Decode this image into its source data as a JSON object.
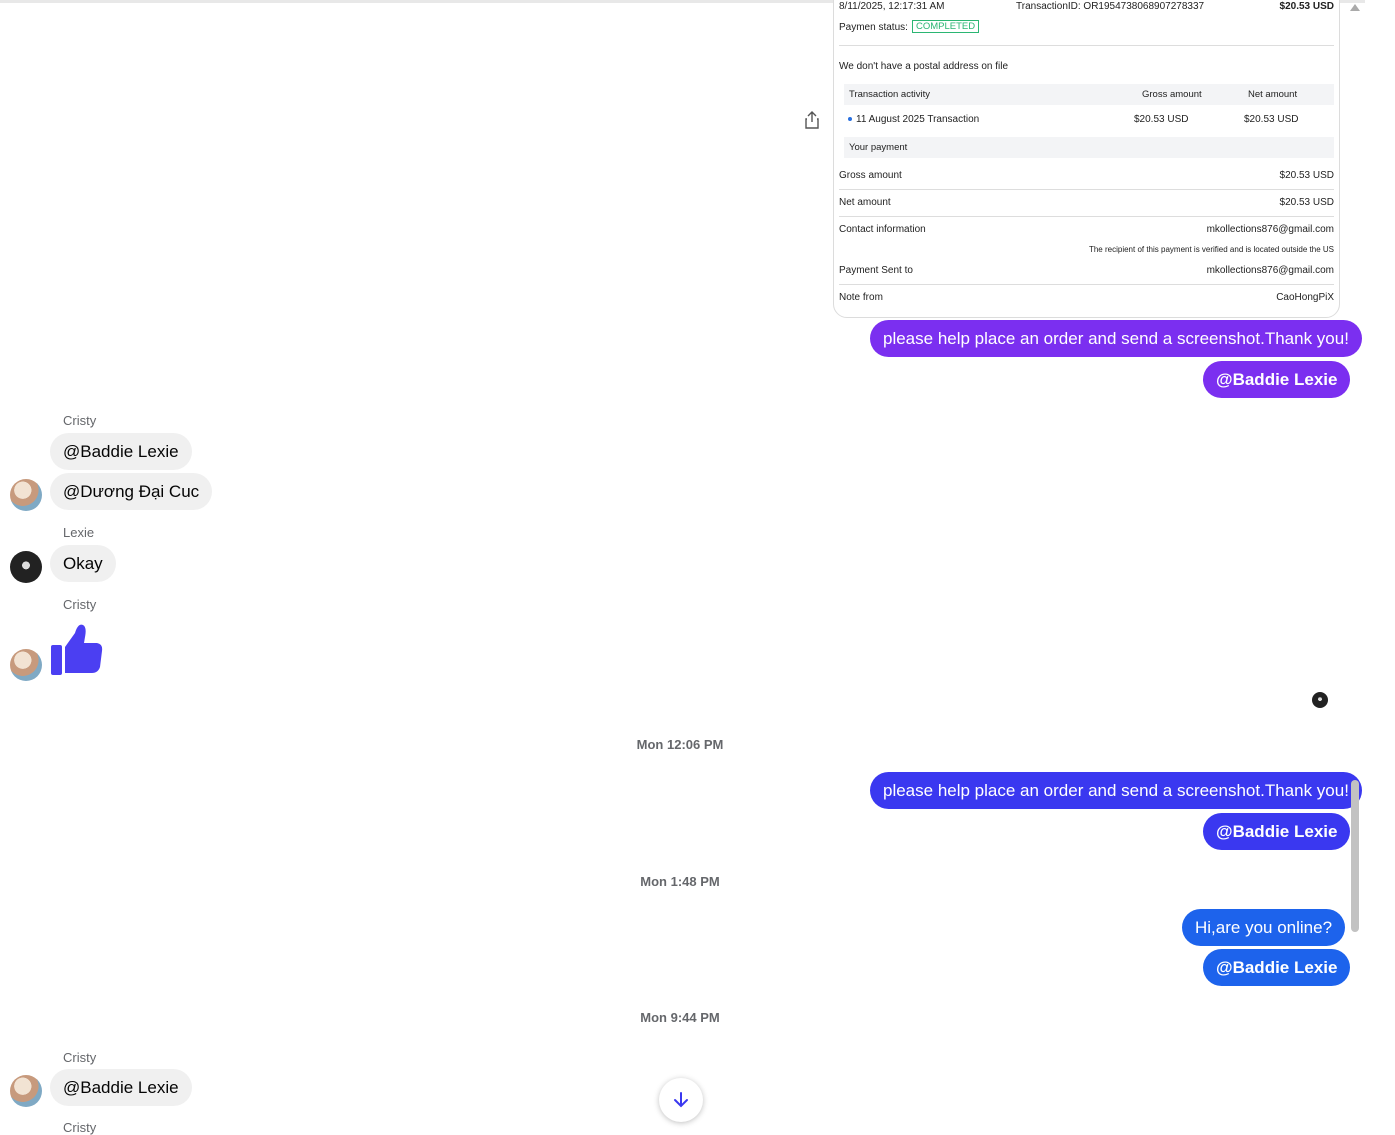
{
  "receipt": {
    "date": "8/11/2025, 12:17:31 AM",
    "transaction_id": "TransactionID: OR1954738068907278337",
    "top_amount": "$20.53 USD",
    "status_label": "Paymen status:",
    "status_value": "COMPLETED",
    "postal_note": "We don't have a postal address on file",
    "table_header": {
      "activity": "Transaction activity",
      "gross": "Gross amount",
      "net": "Net amount"
    },
    "table_row": {
      "activity": "11 August 2025 Transaction",
      "gross": "$20.53 USD",
      "net": "$20.53 USD"
    },
    "your_payment": "Your payment",
    "rows": [
      {
        "label": "Gross amount",
        "value": "$20.53 USD"
      },
      {
        "label": "Net amount",
        "value": "$20.53 USD"
      },
      {
        "label": "Contact information",
        "value": "mkollections876@gmail.com"
      },
      {
        "label": "Payment Sent to",
        "value": "mkollections876@gmail.com"
      },
      {
        "label": "Note from",
        "value": "CaoHongPiX"
      }
    ],
    "verified_note": "The recipient of this payment is verified and is located outside the US"
  },
  "messages": {
    "m1": "please help place an order and send a screenshot.Thank you!",
    "m2": "@Baddie Lexie",
    "sender_cristy_1": "Cristy",
    "m3": "@Baddie Lexie",
    "m4": "@Dương Đại Cuc",
    "sender_lexie": "Lexie",
    "m5": "Okay",
    "sender_cristy_2": "Cristy",
    "stamp_1": "Mon 12:06 PM",
    "m6": "please help place an order and send a screenshot.Thank you!",
    "m7": "@Baddie Lexie",
    "stamp_2": "Mon 1:48 PM",
    "m8": "Hi,are you online?",
    "m9": "@Baddie Lexie",
    "stamp_3": "Mon 9:44 PM",
    "sender_cristy_3": "Cristy",
    "m10": "@Baddie Lexie",
    "sender_cristy_4": "Cristy"
  },
  "colors": {
    "purple": "#7b2ff0",
    "indigo": "#3a38f0",
    "blue": "#1d63ec",
    "like": "#4b3ff2"
  },
  "icons": {
    "share": "share-icon",
    "like": "thumbs-up-icon",
    "scroll_down": "arrow-down-icon"
  }
}
